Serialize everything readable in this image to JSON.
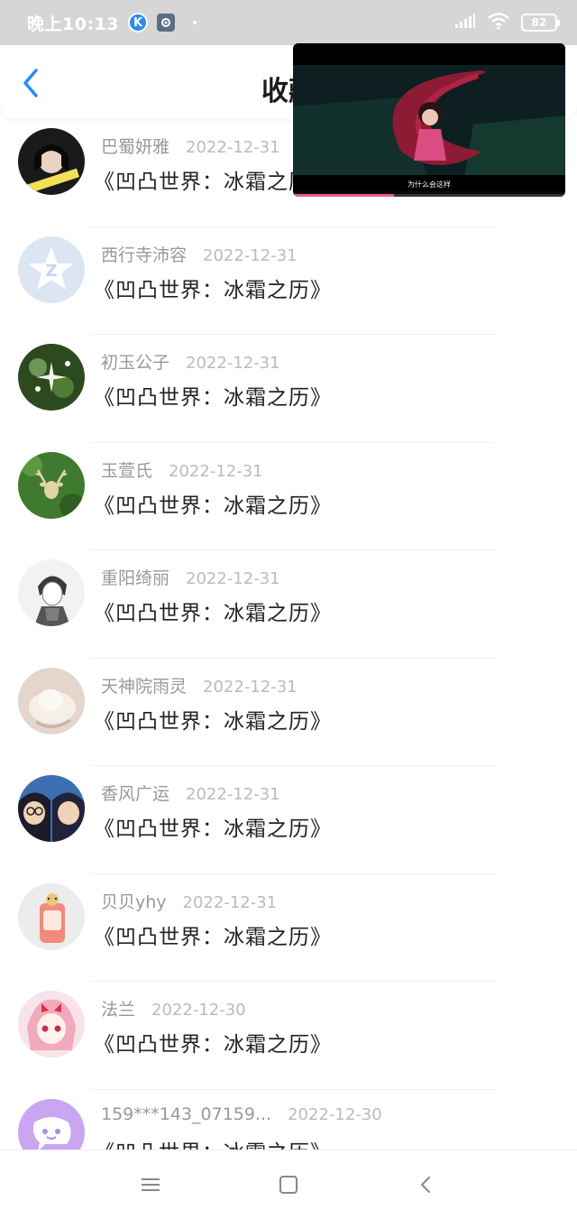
{
  "status_bar": {
    "time": "晚上10:13",
    "app_icon_k": "K",
    "battery": "82",
    "icons": [
      "k-app-icon",
      "settings-app-icon",
      "signal-icon",
      "wifi-icon",
      "battery-icon"
    ]
  },
  "header": {
    "title": "收藏",
    "back_icon": "chevron-left-icon"
  },
  "video": {
    "subtitle": "为什么会这样",
    "progress": 0.37
  },
  "list": {
    "items": [
      {
        "user": "巴蜀妍雅",
        "date": "2022-12-31",
        "title": "《凹凸世界：冰霜之历》"
      },
      {
        "user": "西行寺沛容",
        "date": "2022-12-31",
        "title": "《凹凸世界：冰霜之历》"
      },
      {
        "user": "初玉公子",
        "date": "2022-12-31",
        "title": "《凹凸世界：冰霜之历》"
      },
      {
        "user": "玉萱氏",
        "date": "2022-12-31",
        "title": "《凹凸世界：冰霜之历》"
      },
      {
        "user": "重阳绮丽",
        "date": "2022-12-31",
        "title": "《凹凸世界：冰霜之历》"
      },
      {
        "user": "天神院雨灵",
        "date": "2022-12-31",
        "title": "《凹凸世界：冰霜之历》"
      },
      {
        "user": "香风广运",
        "date": "2022-12-31",
        "title": "《凹凸世界：冰霜之历》"
      },
      {
        "user": "贝贝yhy",
        "date": "2022-12-31",
        "title": "《凹凸世界：冰霜之历》"
      },
      {
        "user": "法兰",
        "date": "2022-12-30",
        "title": "《凹凸世界：冰霜之历》"
      },
      {
        "user": "159***143_07159...",
        "date": "2022-12-30",
        "title": "《凹凸世界：冰霜之历》"
      }
    ]
  },
  "colors": {
    "accent": "#2b8cf5",
    "status_bar": "#d6d6d6",
    "progress": "#e85b8a"
  },
  "nav": {
    "icons": [
      "menu-icon",
      "home-icon",
      "back-icon"
    ]
  }
}
